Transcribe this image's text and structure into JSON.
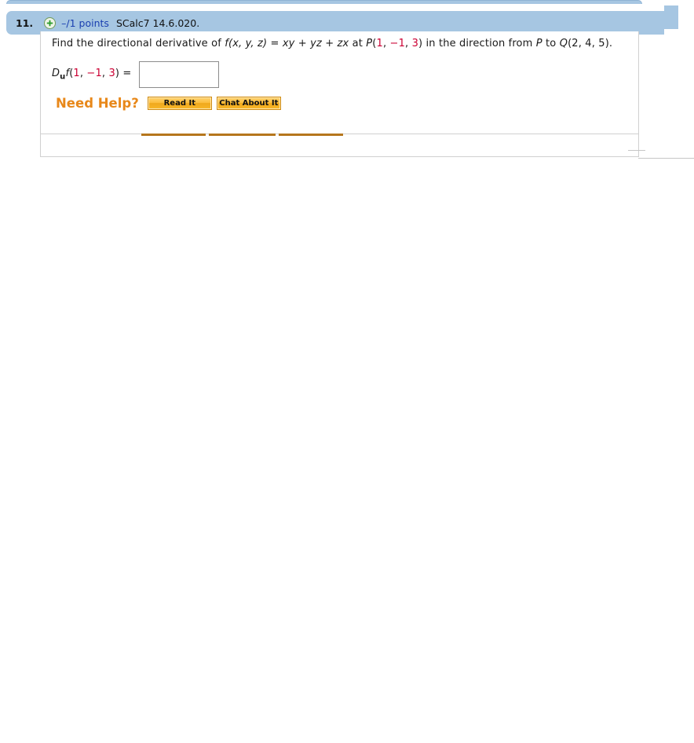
{
  "header": {
    "question_number": "11.",
    "expand_icon": "plus-circle-icon",
    "points": "–/1 points",
    "question_ref": "SCalc7 14.6.020."
  },
  "problem": {
    "prompt_parts": {
      "lead": "Find the directional derivative of ",
      "func_name": "f",
      "func_args": "(x, y, z)",
      "equals": " = ",
      "expression": "xy + yz + zx",
      "at": " at ",
      "point_p_label": "P",
      "point_p_open": "(",
      "point_p_x": "1",
      "point_p_sep1": ", ",
      "point_p_y": "−1",
      "point_p_sep2": ", ",
      "point_p_z": "3",
      "point_p_close": ")",
      "middle": " in the direction from ",
      "from_label": "P",
      "to_word": " to ",
      "point_q_label": "Q",
      "point_q_values": "(2, 4, 5).",
      "full_text": "Find the directional derivative of f(x, y, z) = xy + yz + zx at P(1, −1, 3) in the direction from P to Q(2, 4, 5)."
    },
    "answer": {
      "d_symbol": "D",
      "subscript": "u",
      "f_symbol": "f",
      "open_paren": "(",
      "arg_x": "1",
      "sep1": ", ",
      "arg_y": "−1",
      "sep2": ", ",
      "arg_z": "3",
      "close_paren": ")",
      "equals": " =",
      "value": "",
      "placeholder": ""
    }
  },
  "help": {
    "label": "Need Help?",
    "read_it_label": "Read It",
    "chat_label": "Chat About It"
  },
  "colors": {
    "header_blue": "#a6c6e2",
    "points_blue": "#1a3fb0",
    "value_red": "#cc0033",
    "help_orange": "#e8881a",
    "button_orange": "#f8b829",
    "bar_brown": "#b5761c"
  }
}
